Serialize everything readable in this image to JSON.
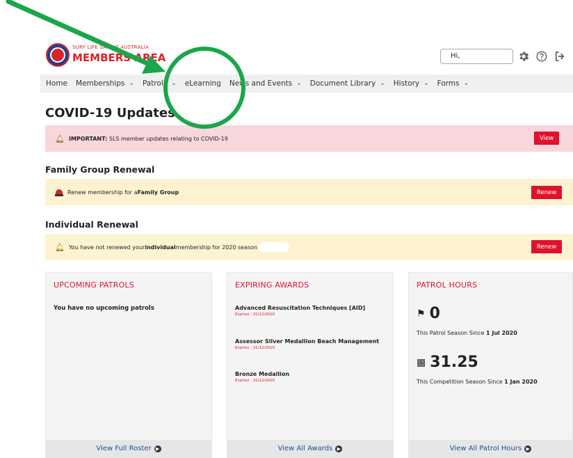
{
  "header": {
    "brand_small": "SURF LIFE SAVING AUSTRALIA",
    "brand_big": "MEMBERS AREA",
    "greeting": "Hi,"
  },
  "icons": {
    "settings": "gear-icon",
    "help": "question-circle-icon",
    "logout": "logout-icon"
  },
  "nav": {
    "items": [
      {
        "label": "Home",
        "dropdown": false
      },
      {
        "label": "Memberships",
        "dropdown": true
      },
      {
        "label": "Patrols",
        "dropdown": true
      },
      {
        "label": "eLearning",
        "dropdown": false
      },
      {
        "label": "News and Events",
        "dropdown": true
      },
      {
        "label": "Document Library",
        "dropdown": true
      },
      {
        "label": "History",
        "dropdown": true
      },
      {
        "label": "Forms",
        "dropdown": true
      }
    ]
  },
  "covid": {
    "title": "COVID-19 Updates",
    "important_label": "IMPORTANT:",
    "message": "SLS member updates relating to COVID-19",
    "button": "View"
  },
  "family": {
    "title": "Family Group Renewal",
    "message_prefix": "Renew membership for a ",
    "message_bold": "Family Group",
    "button": "Renew"
  },
  "individual": {
    "title": "Individual Renewal",
    "message_prefix": "You have not renewed your ",
    "message_bold": "individual",
    "message_suffix": " membership for 2020 season",
    "button": "Renew"
  },
  "cards": {
    "patrols": {
      "title": "UPCOMING PATROLS",
      "empty": "You have no upcoming patrols",
      "footer": "View Full Roster"
    },
    "awards": {
      "title": "EXPIRING AWARDS",
      "items": [
        {
          "name": "Advanced Resuscitation Techniques [AID]",
          "expires": "Expires : 31/12/2020"
        },
        {
          "name": "Assessor Silver Medallion Beach Management",
          "expires": "Expires : 31/12/2020"
        },
        {
          "name": "Bronze Medallion",
          "expires": "Expires : 31/12/2020"
        }
      ],
      "footer": "View All Awards"
    },
    "hours": {
      "title": "PATROL HOURS",
      "patrol_value": "0",
      "patrol_caption_prefix": "This Patrol Season Since ",
      "patrol_caption_bold": "1 Jul 2020",
      "comp_value": "31.25",
      "comp_caption_prefix": "This Competition Season Since ",
      "comp_caption_bold": "1 Jan 2020",
      "footer": "View All Patrol Hours"
    }
  },
  "colors": {
    "accent_red": "#e0112b",
    "annotation_green": "#1aa64a",
    "link_blue": "#1d4e9a"
  }
}
